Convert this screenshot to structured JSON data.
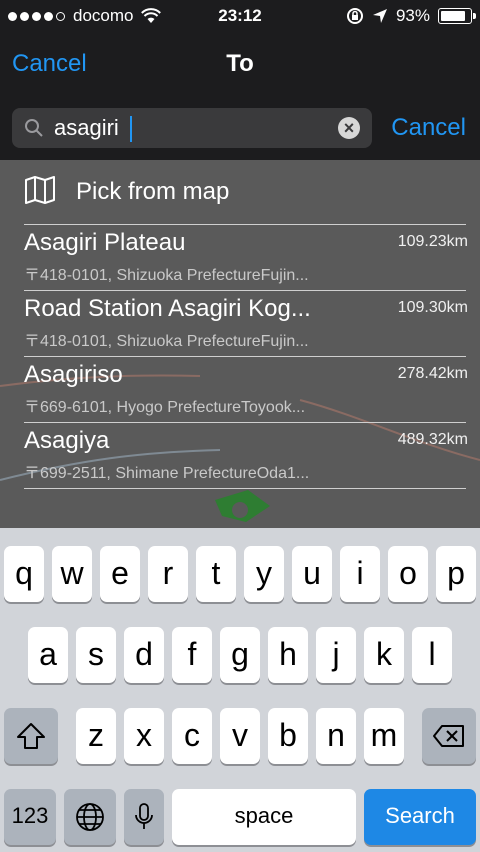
{
  "status_bar": {
    "carrier": "docomo",
    "time": "23:12",
    "battery": "93%",
    "battery_level": 0.93,
    "icons": [
      "signal-dots",
      "wifi-icon",
      "orientation-lock-icon",
      "location-arrow-icon",
      "battery-icon"
    ]
  },
  "nav": {
    "cancel_label": "Cancel",
    "title": "To"
  },
  "search": {
    "value": "asagiri",
    "cancel_label": "Cancel",
    "clear_icon": "clear-icon"
  },
  "results": {
    "pick_from_map": "Pick from map",
    "items": [
      {
        "name": "Asagiri Plateau",
        "address": "〒418-0101, Shizuoka PrefectureFujin...",
        "distance": "109.23km"
      },
      {
        "name": "Road Station Asagiri Kog...",
        "address": "〒418-0101, Shizuoka PrefectureFujin...",
        "distance": "109.30km"
      },
      {
        "name": "Asagiriso",
        "address": "〒669-6101, Hyogo PrefectureToyook...",
        "distance": "278.42km"
      },
      {
        "name": "Asagiya",
        "address": "〒699-2511, Shimane PrefectureOda1...",
        "distance": "489.32km"
      }
    ]
  },
  "keyboard": {
    "row1": [
      "q",
      "w",
      "e",
      "r",
      "t",
      "y",
      "u",
      "i",
      "o",
      "p"
    ],
    "row2": [
      "a",
      "s",
      "d",
      "f",
      "g",
      "h",
      "j",
      "k",
      "l"
    ],
    "row3": [
      "z",
      "x",
      "c",
      "v",
      "b",
      "n",
      "m"
    ],
    "numbers_label": "123",
    "space_label": "space",
    "search_label": "Search"
  },
  "colors": {
    "accent": "#2196f3",
    "search_key": "#1e88e5"
  }
}
